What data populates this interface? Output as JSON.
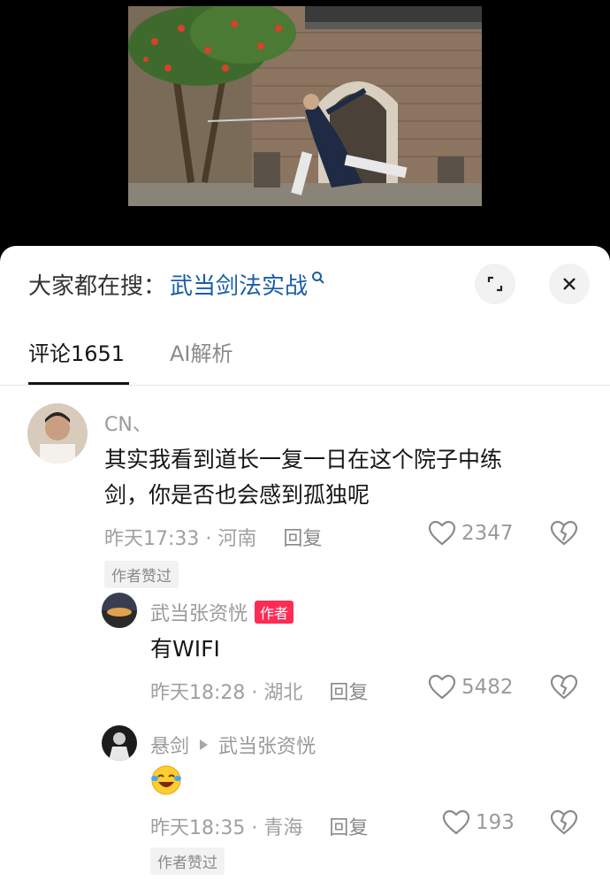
{
  "search": {
    "prefix": "大家都在搜：",
    "term": "武当剑法实战"
  },
  "tabs": {
    "comments": "评论1651",
    "ai": "AI解析"
  },
  "comments": [
    {
      "user": "CN、",
      "text_line1": "其实我看到道长一复一日在这个院子中练",
      "text_line2": "剑，你是否也会感到孤独呢",
      "time": "昨天17:33 · 河南",
      "reply": "回复",
      "likes": "2347",
      "badge": "作者赞过"
    },
    {
      "user": "武当张资恍",
      "author_tag": "作者",
      "text": "有WIFI",
      "time": "昨天18:28 · 湖北",
      "reply": "回复",
      "likes": "5482"
    },
    {
      "user": "悬剑",
      "reply_to": "武当张资恍",
      "time": "昨天18:35 · 青海",
      "reply": "回复",
      "likes": "193",
      "badge": "作者赞过"
    }
  ],
  "colors": {
    "accent_link": "#1a5ea8",
    "author_tag": "#fe2c55"
  }
}
